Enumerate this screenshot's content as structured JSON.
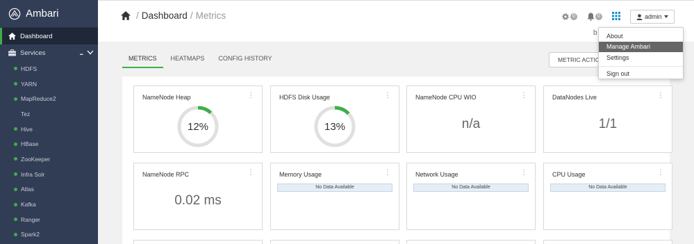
{
  "brand": {
    "name": "Ambari"
  },
  "sidebar": {
    "dashboard_label": "Dashboard",
    "services_label": "Services",
    "services_more": "...",
    "services": [
      {
        "label": "HDFS",
        "status": "green"
      },
      {
        "label": "YARN",
        "status": "green"
      },
      {
        "label": "MapReduce2",
        "status": "green"
      },
      {
        "label": "Tez",
        "status": "none"
      },
      {
        "label": "Hive",
        "status": "green"
      },
      {
        "label": "HBase",
        "status": "green"
      },
      {
        "label": "ZooKeeper",
        "status": "green"
      },
      {
        "label": "Infra Solr",
        "status": "green"
      },
      {
        "label": "Atlas",
        "status": "green"
      },
      {
        "label": "Kafka",
        "status": "green"
      },
      {
        "label": "Ranger",
        "status": "green"
      },
      {
        "label": "Spark2",
        "status": "green"
      }
    ]
  },
  "header": {
    "breadcrumb_current": "Dashboard",
    "breadcrumb_sep": "/",
    "breadcrumb_sub": "Metrics",
    "ops_count": "0",
    "alerts_count": "0",
    "user_label": "admin",
    "hidden_text": "b"
  },
  "tabs": [
    {
      "label": "METRICS",
      "active": true
    },
    {
      "label": "HEATMAPS",
      "active": false
    },
    {
      "label": "CONFIG HISTORY",
      "active": false
    }
  ],
  "metric_actions_label": "METRIC ACTIONS",
  "widgets": {
    "namenode_heap": {
      "title": "NameNode Heap",
      "percent": 12,
      "label": "12%"
    },
    "hdfs_disk": {
      "title": "HDFS Disk Usage",
      "percent": 13,
      "label": "13%"
    },
    "namenode_cpu": {
      "title": "NameNode CPU WIO",
      "value": "n/a"
    },
    "datanodes_live": {
      "title": "DataNodes Live",
      "value": "1/1"
    },
    "namenode_rpc": {
      "title": "NameNode RPC",
      "value": "0.02 ms"
    },
    "memory_usage": {
      "title": "Memory Usage",
      "nodata": "No Data Available"
    },
    "network_usage": {
      "title": "Network Usage",
      "nodata": "No Data Available"
    },
    "cpu_usage": {
      "title": "CPU Usage",
      "nodata": "No Data Available"
    }
  },
  "user_menu": {
    "items": [
      "About",
      "Manage Ambari",
      "Settings",
      "Sign out"
    ]
  },
  "colors": {
    "sidebar_bg": "#313d54",
    "accent_green": "#3fae49",
    "donut_track": "#e0e0e0",
    "grid_blue": "#1a8fc7"
  }
}
